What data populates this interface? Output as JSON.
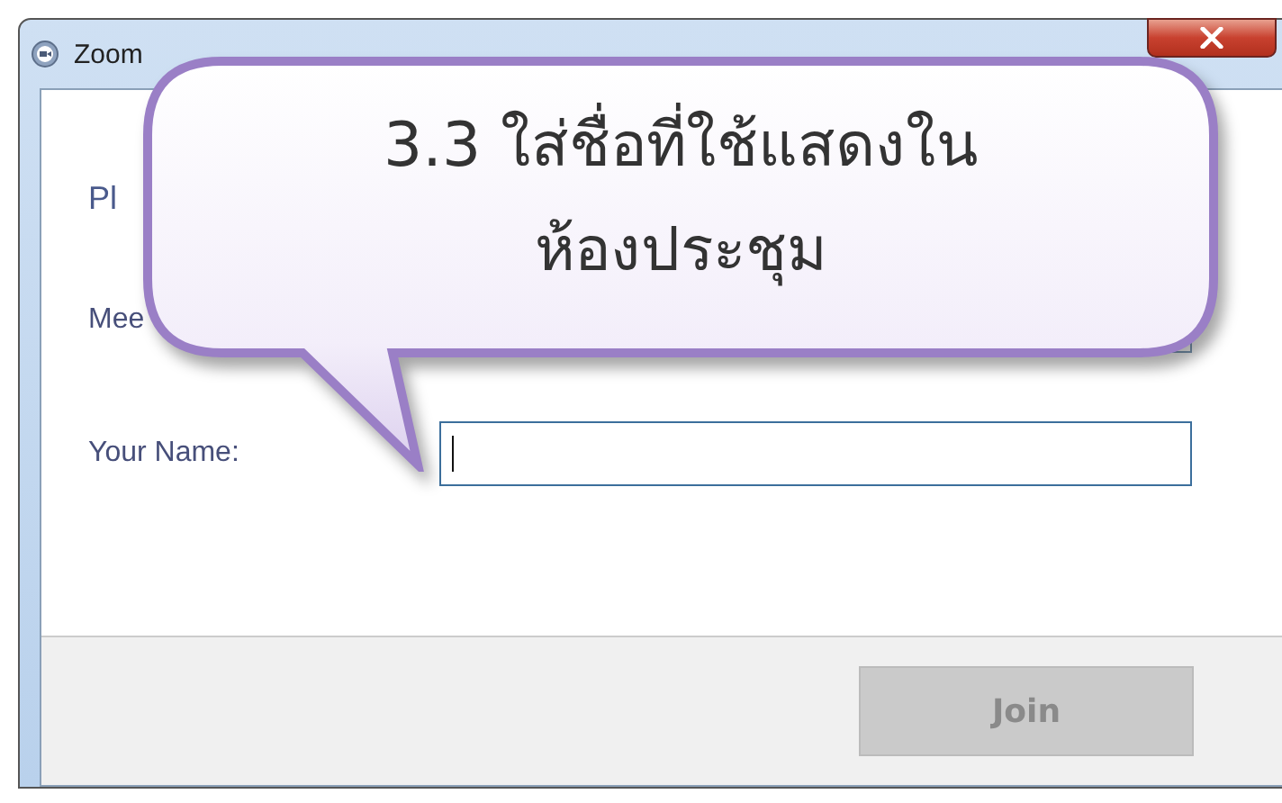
{
  "window": {
    "title": "Zoom"
  },
  "heading": "Pl",
  "meeting_field": {
    "label": "Mee"
  },
  "name_field": {
    "label": "Your Name:",
    "focused": true
  },
  "join_button": {
    "label": "Join",
    "disabled": true
  },
  "callout": {
    "lines": [
      "3.3 ใส่ชื่อที่ใช้แสดงใน",
      "ห้องประชุม"
    ]
  }
}
